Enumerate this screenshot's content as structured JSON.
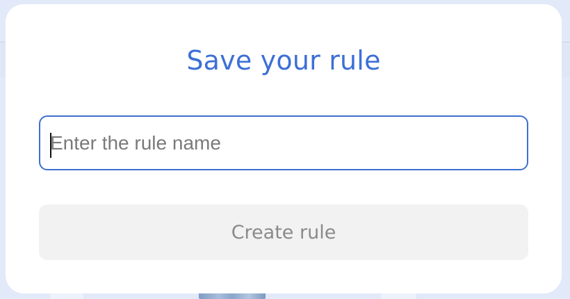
{
  "modal": {
    "title": "Save your rule",
    "input": {
      "value": "",
      "placeholder": "Enter the rule name"
    },
    "create_button": {
      "label": "Create rule",
      "disabled": true
    }
  },
  "colors": {
    "title": "#3d6fd6",
    "input_border": "#3d6fd0",
    "button_bg": "#f2f2f2",
    "button_text": "#8a8a8a",
    "backdrop": "#e2e9f8"
  }
}
